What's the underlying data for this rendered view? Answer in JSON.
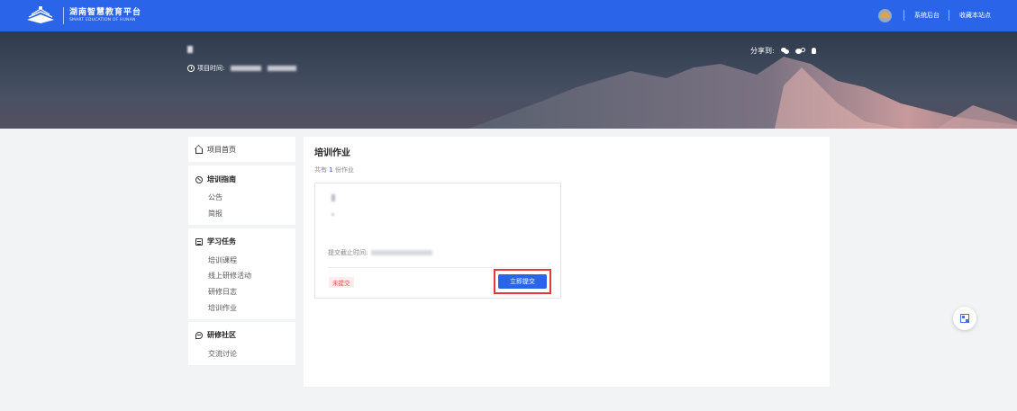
{
  "header": {
    "brand_title": "湖南智慧教育平台",
    "brand_subtitle": "SMART EDUCATION OF HUNAN",
    "links": [
      "系统后台",
      "收藏本站点"
    ]
  },
  "banner": {
    "project_time_label": "项目时间:",
    "share_label": "分享到:",
    "share_icons": [
      "wechat-icon",
      "weibo-icon",
      "qq-icon"
    ]
  },
  "sidebar": {
    "home": "项目首页",
    "sections": [
      {
        "title": "培训指南",
        "icon": "guide-icon",
        "items": [
          "公告",
          "简报"
        ]
      },
      {
        "title": "学习任务",
        "icon": "task-icon",
        "items": [
          "培训课程",
          "线上研修活动",
          "研修日志",
          "培训作业"
        ]
      },
      {
        "title": "研修社区",
        "icon": "community-icon",
        "items": [
          "交流讨论"
        ]
      }
    ]
  },
  "main": {
    "title": "培训作业",
    "count_prefix": "共有",
    "count": "1",
    "count_suffix": "份作业",
    "card": {
      "deadline_label": "提交截止时间:",
      "status": "未提交",
      "submit_label": "立即提交"
    }
  },
  "colors": {
    "primary": "#2a64e8",
    "highlight": "#e23a3a",
    "status_red": "#e04b4b"
  }
}
